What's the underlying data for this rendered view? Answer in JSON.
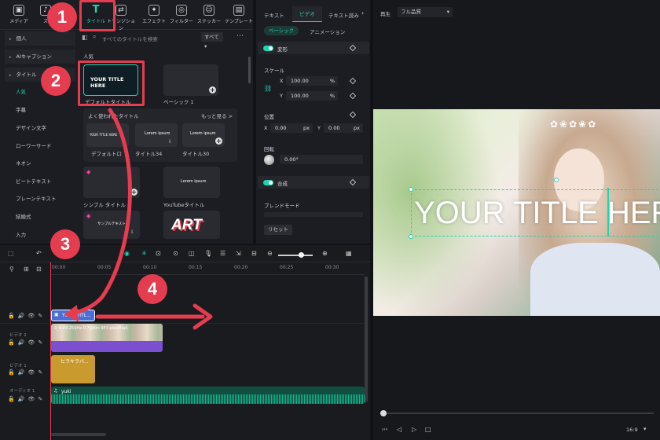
{
  "top_tabs": [
    {
      "label": "メディア",
      "icon": "media-icon"
    },
    {
      "label": "ス",
      "icon": "stock-icon"
    },
    {
      "label": "タイトル",
      "icon": "title-T-icon"
    },
    {
      "label": "トランジション",
      "icon": "transition-icon"
    },
    {
      "label": "エフェクト",
      "icon": "effect-icon"
    },
    {
      "label": "フィルター",
      "icon": "filter-icon"
    },
    {
      "label": "ステッカー",
      "icon": "sticker-icon"
    },
    {
      "label": "テンプレート",
      "icon": "template-icon"
    }
  ],
  "sidebar": {
    "items": [
      {
        "label": "個人"
      },
      {
        "label": "AIキャプション"
      },
      {
        "label": "タイトル"
      },
      {
        "label": "人気"
      },
      {
        "label": "字幕"
      },
      {
        "label": "デザイン文字"
      },
      {
        "label": "ローワーサード"
      },
      {
        "label": "ネオン"
      },
      {
        "label": "ビートテキスト"
      },
      {
        "label": "プレーンテキスト"
      },
      {
        "label": "結婚式"
      },
      {
        "label": "入力"
      }
    ]
  },
  "library": {
    "search_placeholder": "すべてのタイトルを検索",
    "filter_label": "すべて",
    "section_popular": "人気",
    "cards": [
      {
        "label": "デフォルトタイトル",
        "preview": "YOUR TITLE HERE"
      },
      {
        "label": "ベーシック 1",
        "preview": ""
      }
    ],
    "frequent_title": "よく使われたタイトル",
    "more_link": "もっと見る >",
    "frequent_cards": [
      {
        "label": "デフォルトロ",
        "preview": "YOUR TITLE HERE"
      },
      {
        "label": "タイトル34",
        "preview": "Lorem ipsum"
      },
      {
        "label": "タイトル30",
        "preview": "Lorem ipsum"
      }
    ],
    "row3": [
      {
        "label": "シンプル タイトル 3",
        "preview": ""
      },
      {
        "label": "YouTubeタイトル",
        "preview": "Lorem ipsum"
      }
    ],
    "row4": [
      {
        "label": "",
        "preview": "サンプルテキスト"
      },
      {
        "label": "",
        "preview": "ART"
      }
    ]
  },
  "properties": {
    "tabs": [
      "テキスト",
      "ビデオ",
      "テキスト読み"
    ],
    "subtabs": [
      "ベーシック",
      "アニメーション"
    ],
    "transform_label": "変形",
    "scale_label": "スケール",
    "scale_x": "100.00",
    "scale_y": "100.00",
    "percent": "%",
    "position_label": "位置",
    "pos_x": "0.00",
    "pos_y": "0.00",
    "px": "px",
    "x": "X",
    "y": "Y",
    "rotation_label": "回転",
    "rotation_value": "0.00°",
    "composite_label": "合成",
    "blend_label": "ブレンドモード",
    "reset_label": "リセット"
  },
  "player": {
    "label": "再生",
    "quality": "フル品質",
    "overlay_title": "YOUR TITLE HERE",
    "ratio": "16:9"
  },
  "timeline": {
    "ticks": [
      "00:00",
      "00:05",
      "00:10",
      "00:15",
      "00:20",
      "00:25",
      "00:30"
    ],
    "tracks": [
      "ビデオ 2",
      "ビデオ 1",
      "オーディオ 1"
    ],
    "clips": {
      "title_clip": "YOUR TITL...",
      "video_clip": "3_4-03-25SHa 0.7@6m 9P1 pixel8(ai)",
      "video1_clip": "ヒラキラパ...",
      "audio_clip": "yuki"
    }
  },
  "annotations": {
    "badges": [
      "1",
      "2",
      "3",
      "4"
    ]
  },
  "colors": {
    "accent": "#1fd3b5",
    "annotation": "#e53d4f",
    "title_clip": "#4a6fd6",
    "video_clip": "#7b4fd0",
    "audio": "#17b08a"
  }
}
